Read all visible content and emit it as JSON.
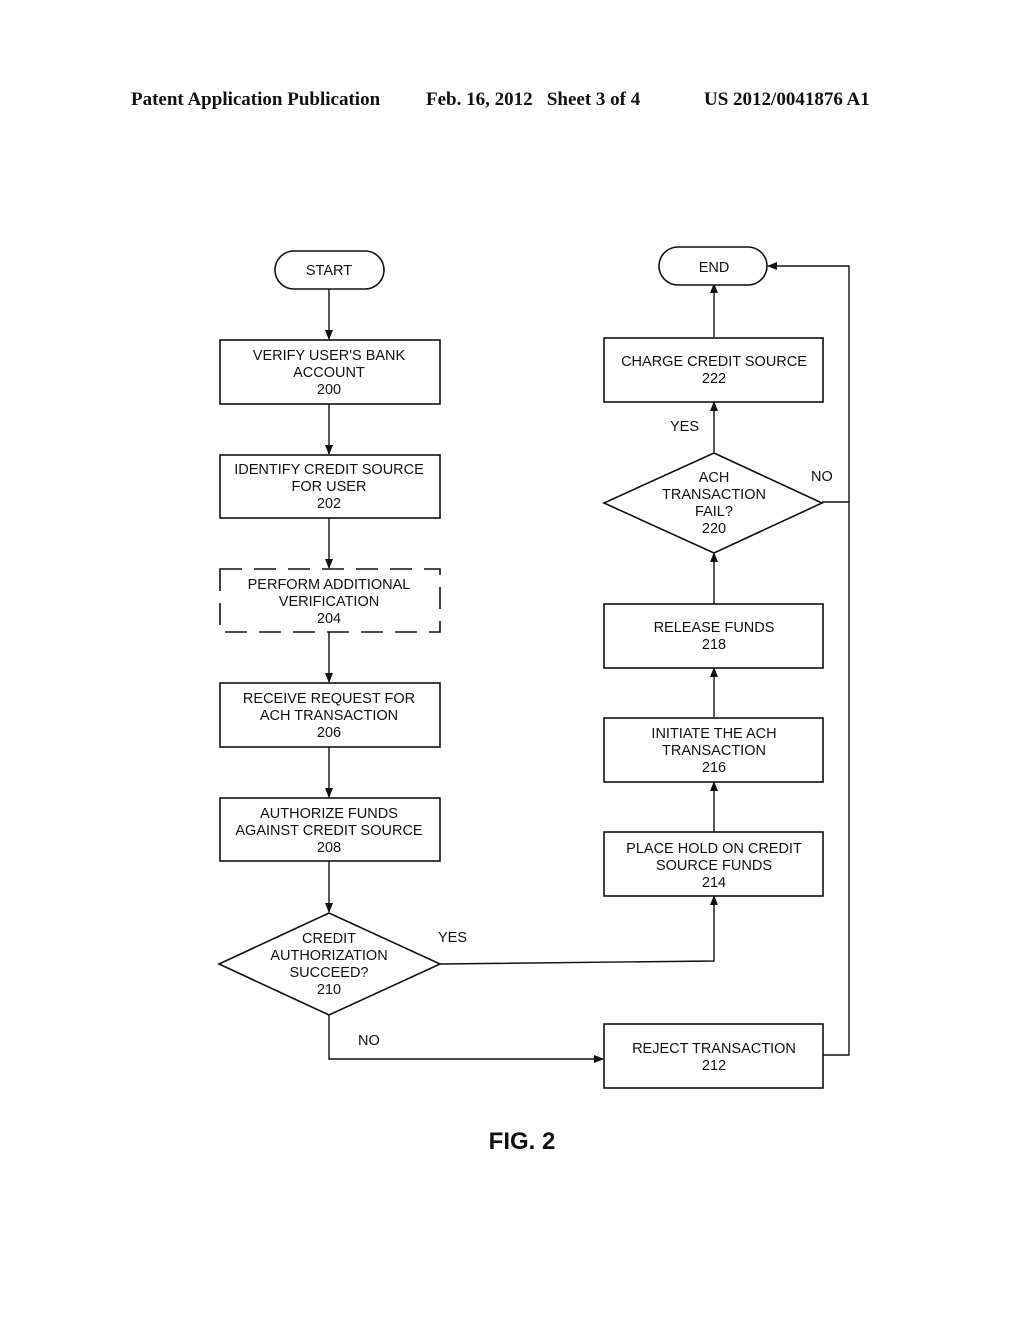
{
  "header": {
    "publication": "Patent Application Publication",
    "date_sheet": "Feb. 16, 2012   Sheet 3 of 4",
    "patent_number": "US 2012/0041876 A1"
  },
  "figure_label": "FIG. 2",
  "nodes": {
    "start": {
      "lines": [
        "START"
      ]
    },
    "n200": {
      "lines": [
        "VERIFY USER'S BANK",
        "ACCOUNT",
        "200"
      ]
    },
    "n202": {
      "lines": [
        "IDENTIFY CREDIT SOURCE",
        "FOR USER",
        "202"
      ]
    },
    "n204": {
      "lines": [
        "PERFORM ADDITIONAL",
        "VERIFICATION",
        "204"
      ],
      "optional": true
    },
    "n206": {
      "lines": [
        "RECEIVE REQUEST FOR",
        "ACH TRANSACTION",
        "206"
      ]
    },
    "n208": {
      "lines": [
        "AUTHORIZE FUNDS",
        "AGAINST CREDIT SOURCE",
        "208"
      ]
    },
    "n210": {
      "lines": [
        "CREDIT",
        "AUTHORIZATION",
        "SUCCEED?",
        "210"
      ]
    },
    "n212": {
      "lines": [
        "REJECT TRANSACTION",
        "212"
      ]
    },
    "n214": {
      "lines": [
        "PLACE HOLD ON CREDIT",
        "SOURCE FUNDS",
        "214"
      ]
    },
    "n216": {
      "lines": [
        "INITIATE THE ACH",
        "TRANSACTION",
        "216"
      ]
    },
    "n218": {
      "lines": [
        "RELEASE FUNDS",
        "218"
      ]
    },
    "n220": {
      "lines": [
        "ACH",
        "TRANSACTION",
        "FAIL?",
        "220"
      ]
    },
    "n222": {
      "lines": [
        "CHARGE CREDIT SOURCE",
        "222"
      ]
    },
    "end": {
      "lines": [
        "END"
      ]
    }
  },
  "edge_labels": {
    "d210_yes": "YES",
    "d210_no": "NO",
    "d220_yes": "YES",
    "d220_no": "NO"
  }
}
